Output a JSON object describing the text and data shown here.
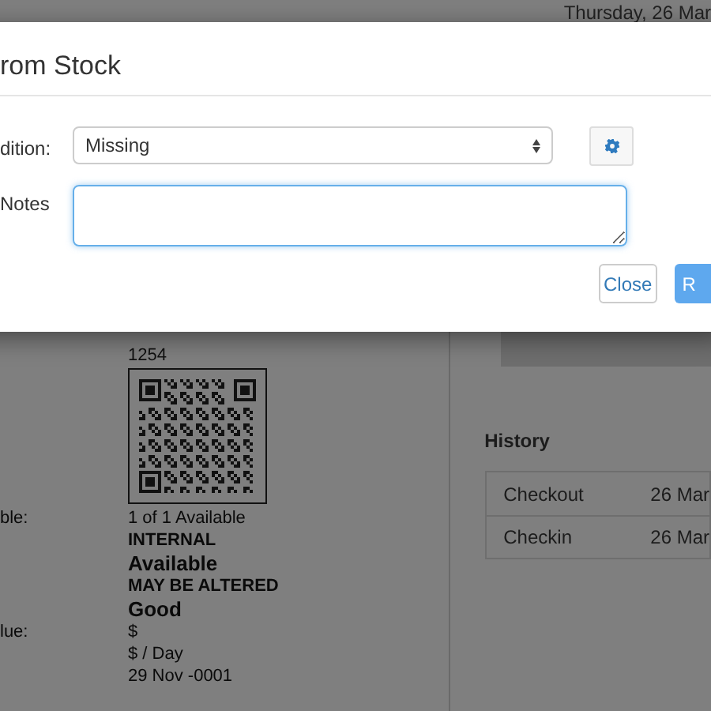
{
  "header": {
    "date": "Thursday, 26 Mar"
  },
  "details": {
    "code": "1254",
    "rows": [
      {
        "label": "ble:",
        "value": "1 of 1 Available",
        "kind": "plain"
      },
      {
        "value": "INTERNAL",
        "kind": "caps"
      },
      {
        "value": "Available",
        "kind": "large"
      },
      {
        "value": "MAY BE ALTERED",
        "kind": "caps"
      },
      {
        "value": "Good",
        "kind": "large"
      },
      {
        "label": "lue:",
        "value": "$",
        "kind": "plain"
      },
      {
        "value": "$ / Day",
        "kind": "plain"
      },
      {
        "value": "29 Nov -0001",
        "kind": "plain"
      }
    ]
  },
  "history": {
    "title": "History",
    "rows": [
      {
        "event": "Checkout",
        "date": "26 Mar"
      },
      {
        "event": "Checkin",
        "date": "26 Mar"
      }
    ]
  },
  "modal": {
    "title": "rom Stock",
    "fields": [
      {
        "label": "dition:",
        "kind": "select",
        "value": "Missing"
      },
      {
        "label": "Notes",
        "kind": "textarea"
      }
    ],
    "buttons": [
      {
        "label": "Close",
        "kind": "default"
      },
      {
        "label": "R",
        "kind": "primary"
      }
    ]
  }
}
